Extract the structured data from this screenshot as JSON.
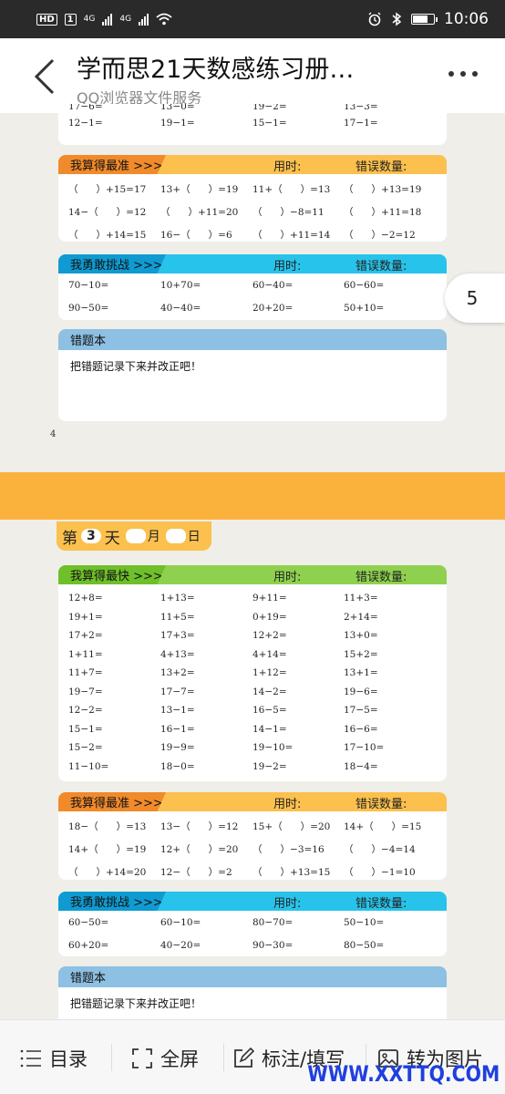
{
  "status": {
    "left_text": [
      "HD",
      "1",
      "4G",
      "4G"
    ],
    "time": "10:06"
  },
  "titlebar": {
    "title": "学而思21天数感练习册…",
    "subtitle": "QQ浏览器文件服务"
  },
  "float_page": "5",
  "page4": {
    "top_partial": {
      "row1": [
        "17−6=",
        "13−0=",
        "19−2=",
        "13−3="
      ],
      "row2": [
        "12−1=",
        "19−1=",
        "15−1=",
        "17−1="
      ]
    },
    "accurate": {
      "title": "我算得最准 >>>",
      "time_label": "用时:",
      "err_label": "错误数量:",
      "rows": [
        [
          "（      ）+15=17",
          "13+（      ）=19",
          "11+（      ）=13",
          "（      ）+13=19"
        ],
        [
          "14−（      ）=12",
          "（      ）+11=20",
          "（      ）−8=11",
          "（      ）+11=18"
        ],
        [
          "（      ）+14=15",
          "16−（      ）=6",
          "（      ）+11=14",
          "（      ）−2=12"
        ]
      ]
    },
    "challenge": {
      "title": "我勇敢挑战 >>>",
      "time_label": "用时:",
      "err_label": "错误数量:",
      "rows": [
        [
          "70−10=",
          "10+70=",
          "60−40=",
          "60−60="
        ],
        [
          "90−50=",
          "40−40=",
          "20+20=",
          "50+10="
        ]
      ]
    },
    "mistakes": {
      "title": "错题本",
      "note": "把错题记录下来并改正吧！"
    },
    "page_number": "4"
  },
  "page5": {
    "day": {
      "prefix": "第",
      "num": "3",
      "day_word": "天",
      "month": "月",
      "date": "日"
    },
    "fast": {
      "title": "我算得最快 >>>",
      "time_label": "用时:",
      "err_label": "错误数量:",
      "rows": [
        [
          "12+8=",
          "1+13=",
          "9+11=",
          "11+3="
        ],
        [
          "19+1=",
          "11+5=",
          "0+19=",
          "2+14="
        ],
        [
          "17+2=",
          "17+3=",
          "12+2=",
          "13+0="
        ],
        [
          "1+11=",
          "4+13=",
          "4+14=",
          "15+2="
        ],
        [
          "11+7=",
          "13+2=",
          "1+12=",
          "13+1="
        ],
        [
          "19−7=",
          "17−7=",
          "14−2=",
          "19−6="
        ],
        [
          "12−2=",
          "13−1=",
          "16−5=",
          "17−5="
        ],
        [
          "15−1=",
          "16−1=",
          "14−1=",
          "16−6="
        ],
        [
          "15−2=",
          "19−9=",
          "19−10=",
          "17−10="
        ],
        [
          "11−10=",
          "18−0=",
          "19−2=",
          "18−4="
        ]
      ]
    },
    "accurate": {
      "title": "我算得最准 >>>",
      "time_label": "用时:",
      "err_label": "错误数量:",
      "rows": [
        [
          "18−（      ）=13",
          "13−（      ）=12",
          "15+（      ）=20",
          "14+（      ）=15"
        ],
        [
          "14+（      ）=19",
          "12+（      ）=20",
          "（      ）−3=16",
          "（      ）−4=14"
        ],
        [
          "（      ）+14=20",
          "12−（      ）=2",
          "（      ）+13=15",
          "（      ）−1=10"
        ]
      ]
    },
    "challenge": {
      "title": "我勇敢挑战 >>>",
      "time_label": "用时:",
      "err_label": "错误数量:",
      "rows": [
        [
          "60−50=",
          "60−10=",
          "80−70=",
          "50−10="
        ],
        [
          "60+20=",
          "40−20=",
          "90−30=",
          "80−50="
        ]
      ]
    },
    "mistakes": {
      "title": "错题本",
      "note": "把错题记录下来并改正吧！"
    }
  },
  "toolbar": {
    "catalog": "目录",
    "fullscreen": "全屏",
    "annotate": "标注/填写",
    "to_image": "转为图片"
  },
  "watermark": "WWW.XXTTQ.COM"
}
